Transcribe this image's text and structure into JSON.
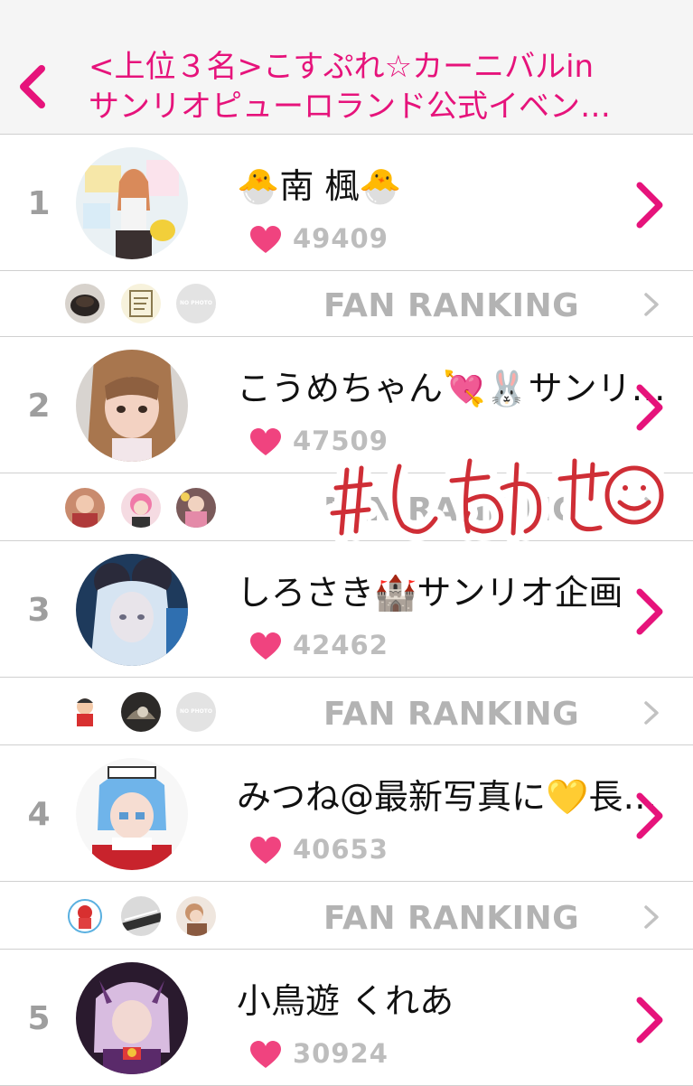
{
  "header": {
    "title_line1": "<上位３名>こすぷれ☆カーニバルin",
    "title_line2": "サンリオピューロランド公式イベン…"
  },
  "rankings": [
    {
      "rank": "1",
      "name": "🐣南 楓🐣",
      "score": "49409"
    },
    {
      "rank": "2",
      "name": "こうめちゃん💘🐰サンリ…",
      "score": "47509"
    },
    {
      "rank": "3",
      "name": "しろさき🏰サンリオ企画",
      "score": "42462"
    },
    {
      "rank": "4",
      "name": "みつね@最新写真に💛長…",
      "score": "40653"
    },
    {
      "rank": "5",
      "name": "小鳥遊 くれあ",
      "score": "30924"
    }
  ],
  "fan_ranking": {
    "label": "FAN RANKING",
    "no_photo": "NO PHOTO"
  },
  "overlay": {
    "stamp_text": "#しあわせ☺"
  },
  "colors": {
    "accent": "#e6137b",
    "heart": "#f0437f",
    "muted": "#b3b3b3"
  }
}
